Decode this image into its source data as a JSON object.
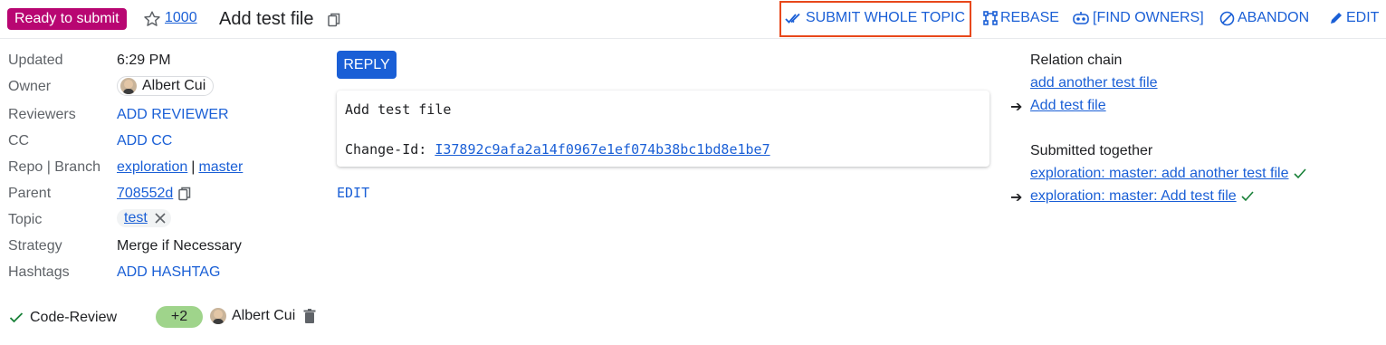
{
  "header": {
    "status": "Ready to submit",
    "change_number": "1000",
    "subject": "Add test file",
    "actions": {
      "submit_whole_topic": "SUBMIT WHOLE TOPIC",
      "rebase": "REBASE",
      "find_owners": "[FIND OWNERS]",
      "abandon": "ABANDON",
      "edit": "EDIT"
    }
  },
  "metadata": {
    "updated_label": "Updated",
    "updated_value": "6:29 PM",
    "owner_label": "Owner",
    "owner_value": "Albert Cui",
    "reviewers_label": "Reviewers",
    "reviewers_value": "ADD REVIEWER",
    "cc_label": "CC",
    "cc_value": "ADD CC",
    "repo_branch_label": "Repo | Branch",
    "repo_value": "exploration",
    "separator": "|",
    "branch_value": "master",
    "parent_label": "Parent",
    "parent_value": "708552d",
    "topic_label": "Topic",
    "topic_value": "test",
    "strategy_label": "Strategy",
    "strategy_value": "Merge if Necessary",
    "hashtags_label": "Hashtags",
    "hashtags_value": "ADD HASHTAG"
  },
  "labels": {
    "code_review_label": "Code-Review",
    "vote": "+2",
    "voter": "Albert Cui"
  },
  "main": {
    "reply_label": "REPLY",
    "commit_subject": "Add test file",
    "change_id_prefix": "Change-Id: ",
    "change_id": "I37892c9afa2a14f0967e1ef074b38bc1bd8e1be7",
    "edit_label": "EDIT"
  },
  "related": {
    "relation_chain_heading": "Relation chain",
    "relation_chain": [
      "add another test file",
      "Add test file"
    ],
    "submitted_together_heading": "Submitted together",
    "submitted_together": [
      "exploration: master: add another test file",
      "exploration: master: Add test file"
    ],
    "arrow": "➔"
  },
  "colors": {
    "status_chip": "#b80672",
    "link": "#1a5fd6",
    "vote_chip": "#9fd48b",
    "highlight": "#e8481b",
    "check": "#188038"
  }
}
